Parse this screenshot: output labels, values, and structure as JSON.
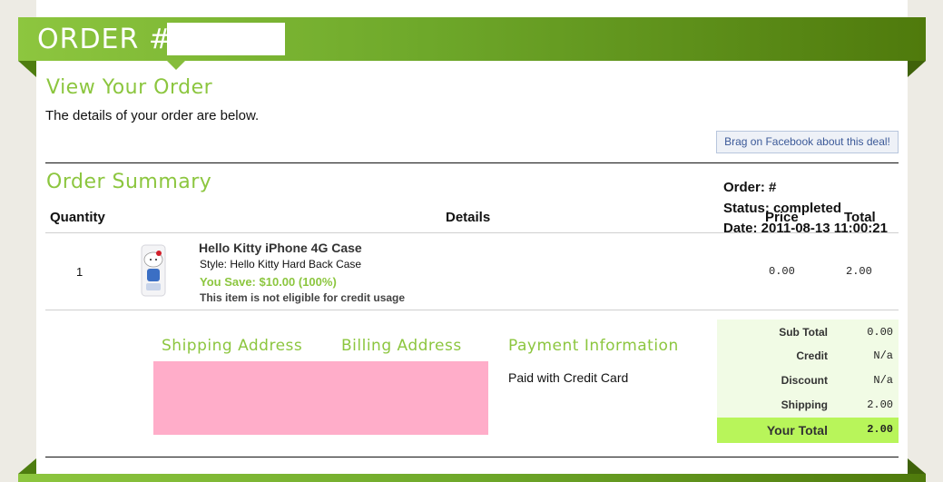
{
  "header": {
    "order_title": "ORDER #"
  },
  "view": {
    "title": "View Your Order",
    "intro": "The details of your order are below.",
    "facebook_button": "Brag on Facebook about this deal!"
  },
  "summary": {
    "title": "Order Summary",
    "order_label": "Order: #",
    "status": "Status: completed",
    "date": "Date: 2011-08-13 11:00:21",
    "columns": {
      "quantity": "Quantity",
      "details": "Details",
      "price": "Price",
      "total": "Total"
    },
    "item": {
      "quantity": "1",
      "name": "Hello Kitty iPhone 4G Case",
      "style_label": "Style:",
      "style_value": "Hello Kitty Hard Back Case",
      "savings": "You Save: $10.00 (100%)",
      "note": "This item is not eligible for credit usage",
      "price": "0.00",
      "total": "2.00",
      "thumbnail_icon": "hello-kitty-phone-case-image"
    }
  },
  "addresses": {
    "shipping_title": "Shipping Address",
    "billing_title": "Billing Address",
    "payment_title": "Payment Information",
    "payment_text": "Paid with Credit Card"
  },
  "totals": {
    "rows": [
      {
        "label": "Sub Total",
        "value": "0.00"
      },
      {
        "label": "Credit",
        "value": "N/a"
      },
      {
        "label": "Discount",
        "value": "N/a"
      },
      {
        "label": "Shipping",
        "value": "2.00"
      }
    ],
    "grand_label": "Your Total",
    "grand_value": "2.00"
  },
  "colors": {
    "accent_green": "#8cc63f",
    "banner_dark": "#4f7a0c",
    "total_highlight": "#b8f55a",
    "redaction_pink": "#ffadc9"
  }
}
